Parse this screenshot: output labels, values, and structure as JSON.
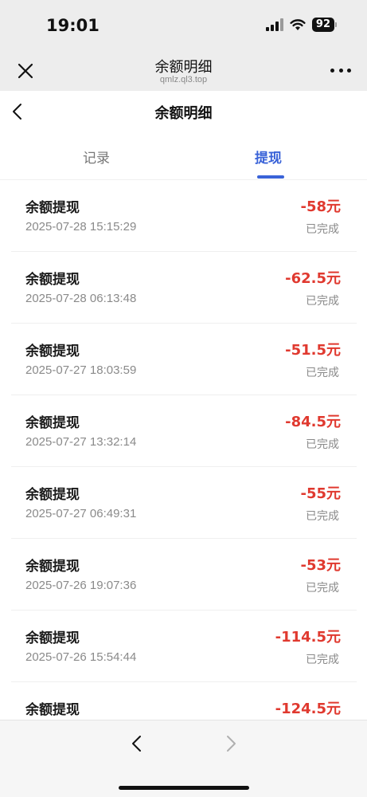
{
  "status_bar": {
    "time": "19:01",
    "battery": "92",
    "icons": [
      "signal-icon",
      "wifi-icon",
      "battery-icon"
    ]
  },
  "web_header": {
    "title": "余额明细",
    "url": "qmlz.ql3.top",
    "close_icon": "close-icon",
    "more_icon": "more-icon"
  },
  "page": {
    "title": "余额明细",
    "back_icon": "chevron-left-icon"
  },
  "tabs": [
    {
      "label": "记录",
      "active": false
    },
    {
      "label": "提现",
      "active": true
    }
  ],
  "colors": {
    "accent": "#3a63d8",
    "amount": "#e0392f",
    "muted": "#8a8a8a"
  },
  "transactions": [
    {
      "title": "余额提现",
      "time": "2025-07-28 15:15:29",
      "amount": "-58元",
      "status": "已完成"
    },
    {
      "title": "余额提现",
      "time": "2025-07-28 06:13:48",
      "amount": "-62.5元",
      "status": "已完成"
    },
    {
      "title": "余额提现",
      "time": "2025-07-27 18:03:59",
      "amount": "-51.5元",
      "status": "已完成"
    },
    {
      "title": "余额提现",
      "time": "2025-07-27 13:32:14",
      "amount": "-84.5元",
      "status": "已完成"
    },
    {
      "title": "余额提现",
      "time": "2025-07-27 06:49:31",
      "amount": "-55元",
      "status": "已完成"
    },
    {
      "title": "余额提现",
      "time": "2025-07-26 19:07:36",
      "amount": "-53元",
      "status": "已完成"
    },
    {
      "title": "余额提现",
      "time": "2025-07-26 15:54:44",
      "amount": "-114.5元",
      "status": "已完成"
    },
    {
      "title": "余额提现",
      "time": "",
      "amount": "-124.5元",
      "status": ""
    }
  ],
  "bottom_bar": {
    "back_icon": "chevron-left-icon",
    "forward_icon": "chevron-right-icon"
  }
}
